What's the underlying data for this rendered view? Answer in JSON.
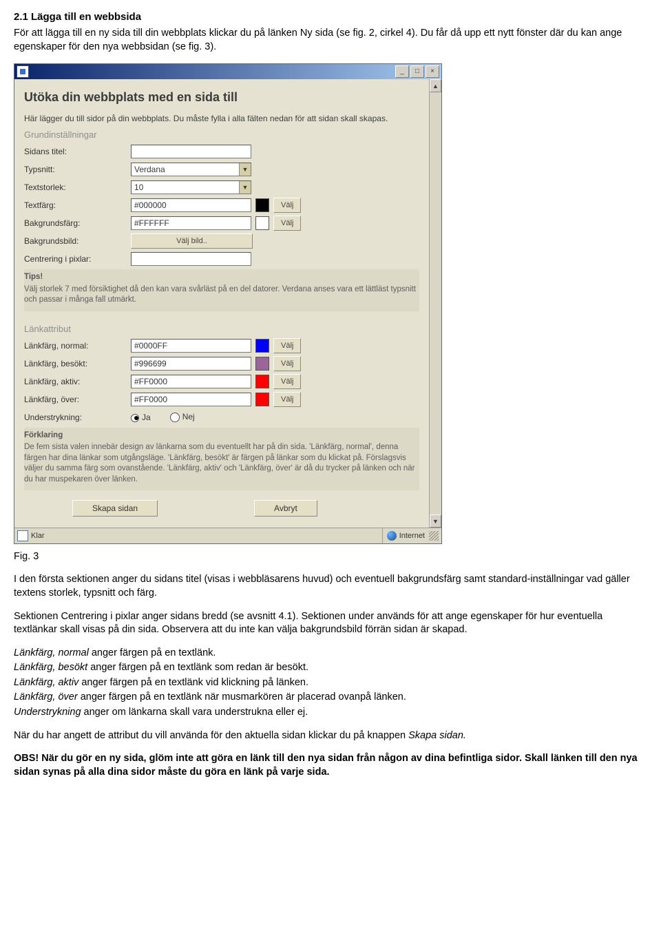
{
  "doc": {
    "heading": "2.1 Lägga till en webbsida",
    "intro": "För att lägga till en ny sida till din webbplats klickar du på länken Ny sida (se fig. 2, cirkel 4). Du får då upp ett nytt fönster där du kan ange egenskaper för den nya webbsidan (se fig. 3).",
    "caption": "Fig. 3",
    "para1": "I den första sektionen anger du sidans titel (visas i webbläsarens huvud) och eventuell bakgrundsfärg samt standard-inställningar vad gäller textens storlek, typsnitt och färg.",
    "para2": "Sektionen Centrering i pixlar anger sidans bredd (se avsnitt 4.1). Sektionen under används för att ange egenskaper för hur eventuella textlänkar skall visas på din sida. Observera att du inte kan välja bakgrundsbild förrän sidan är skapad.",
    "lines": {
      "l1a": "Länkfärg, normal",
      "l1b": " anger färgen på en textlänk.",
      "l2a": "Länkfärg, besökt",
      "l2b": " anger färgen på en textlänk som redan är besökt.",
      "l3a": "Länkfärg, aktiv",
      "l3b": " anger färgen på en textlänk vid klickning på länken.",
      "l4a": "Länkfärg, över",
      "l4b": " anger färgen på en textlänk när musmarkören är placerad ovanpå länken.",
      "l5a": "Understrykning",
      "l5b": " anger om länkarna skall vara understrukna eller ej."
    },
    "para3a": "När du har angett de attribut du vill använda för den aktuella sidan klickar du på knappen ",
    "para3b": "Skapa sidan.",
    "obs_label": "OBS!",
    "obs_text": " När du gör en ny sida, glöm inte att göra en länk till den nya sidan från någon av dina befintliga sidor. Skall länken till den nya sidan synas på alla dina sidor måste du göra en länk på varje sida."
  },
  "win": {
    "title": "Utöka din webbplats med en sida till",
    "intro": "Här lägger du till sidor på din webbplats. Du måste fylla i alla fälten nedan för att sidan skall skapas.",
    "sec1": "Grundinställningar",
    "rows1": {
      "titel": {
        "label": "Sidans titel:",
        "value": ""
      },
      "typsnitt": {
        "label": "Typsnitt:",
        "value": "Verdana"
      },
      "storlek": {
        "label": "Textstorlek:",
        "value": "10"
      },
      "textfarg": {
        "label": "Textfärg:",
        "value": "#000000",
        "swatch": "#000000"
      },
      "bgfarg": {
        "label": "Bakgrundsfärg:",
        "value": "#FFFFFF",
        "swatch": "#FFFFFF"
      },
      "bgbild": {
        "label": "Bakgrundsbild:",
        "button": "Välj bild.."
      },
      "centr": {
        "label": "Centrering i pixlar:",
        "value": ""
      }
    },
    "valj": "Välj",
    "tips_hdr": "Tips!",
    "tips": "Välj storlek 7 med försiktighet då den kan vara svårläst på en del datorer. Verdana anses vara ett lättläst typsnitt och passar i många fall utmärkt.",
    "sec2": "Länkattribut",
    "rows2": {
      "normal": {
        "label": "Länkfärg, normal:",
        "value": "#0000FF",
        "swatch": "#0000FF"
      },
      "besokt": {
        "label": "Länkfärg, besökt:",
        "value": "#996699",
        "swatch": "#996699"
      },
      "aktiv": {
        "label": "Länkfärg, aktiv:",
        "value": "#FF0000",
        "swatch": "#FF0000"
      },
      "over": {
        "label": "Länkfärg, över:",
        "value": "#FF0000",
        "swatch": "#FF0000"
      }
    },
    "under_label": "Understrykning:",
    "ja": "Ja",
    "nej": "Nej",
    "expl_hdr": "Förklaring",
    "expl": "De fem sista valen innebär design av länkarna som du eventuellt har på din sida. 'Länkfärg, normal', denna färgen har dina länkar som utgångsläge. 'Länkfärg, besökt' är färgen på länkar som du klickat på. Förslagsvis väljer du samma färg som ovanstående. 'Länkfärg, aktiv' och 'Länkfärg, över' är då du trycker på länken och när du har muspekaren över länken.",
    "btn_create": "Skapa sidan",
    "btn_cancel": "Avbryt",
    "status_ready": "Klar",
    "status_zone": "Internet"
  },
  "colors": {
    "textfarg": "#000000",
    "bgfarg": "#FFFFFF",
    "normal": "#0000FF",
    "besokt": "#996699",
    "aktiv": "#FF0000",
    "over": "#FF0000"
  }
}
